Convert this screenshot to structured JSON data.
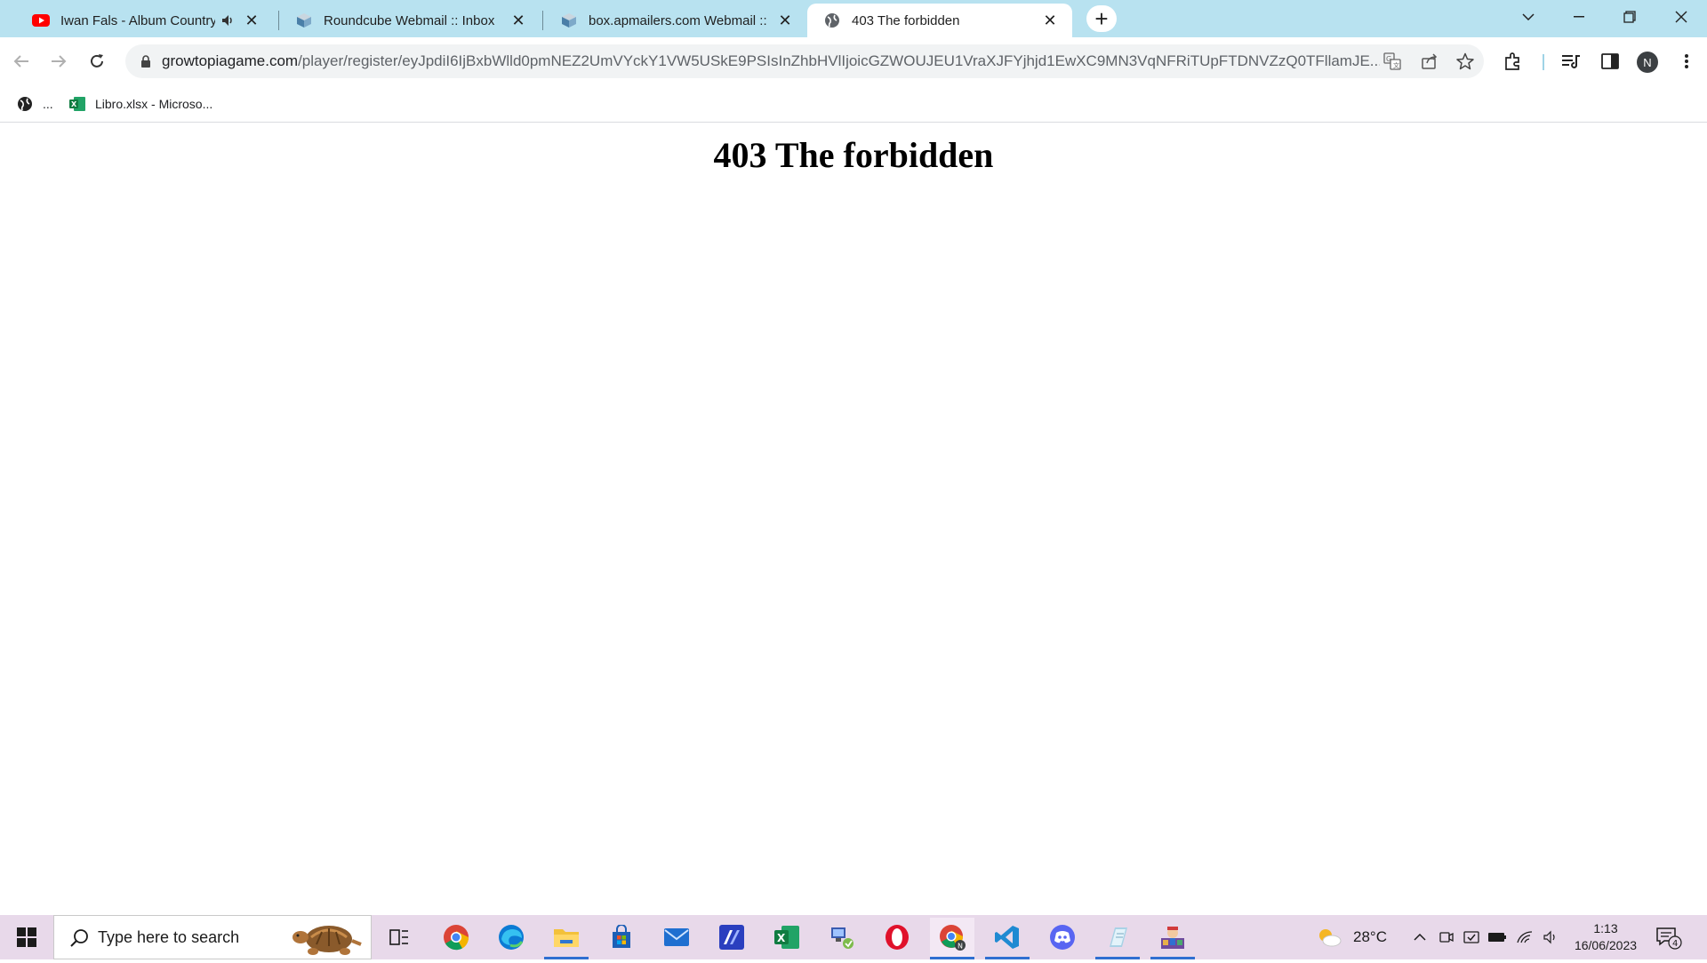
{
  "browser": {
    "tabs": [
      {
        "title": "Iwan Fals - Album Country |",
        "favicon": "youtube-icon",
        "audio": true,
        "active": false
      },
      {
        "title": "Roundcube Webmail :: Inbox",
        "favicon": "roundcube-icon",
        "active": false
      },
      {
        "title": "box.apmailers.com Webmail :: In",
        "favicon": "roundcube-icon",
        "active": false
      },
      {
        "title": "403 The forbidden",
        "favicon": "globe-icon",
        "active": true
      }
    ],
    "address_bar": {
      "host": "growtopiagame.com",
      "path": "/player/register/eyJpdiI6IjBxbWlld0pmNEZ2UmVYckY1VW5USkE9PSIsInZhbHVlIjoicGZWOUJEU1VraXJFYjhjd1EwXC9MN3VqNFRiTUpFTDNVZzQ0TFllamJE..."
    },
    "profile_initial": "N",
    "bookmarks": [
      {
        "label": "...",
        "icon": "globe-icon"
      },
      {
        "label": "Libro.xlsx - Microso...",
        "icon": "excel-icon"
      }
    ]
  },
  "page": {
    "heading": "403 The forbidden"
  },
  "taskbar": {
    "search_placeholder": "Type here to search",
    "apps": [
      "task-view",
      "chrome",
      "edge",
      "file-explorer",
      "microsoft-store",
      "mail",
      "editor",
      "excel",
      "network-tool",
      "opera",
      "chrome-profile",
      "vscode",
      "discord",
      "notepad",
      "game"
    ],
    "weather": {
      "temp": "28°C",
      "icon": "sun-cloud-icon"
    },
    "clock": {
      "time": "1:13",
      "date": "16/06/2023"
    },
    "notifications": "4"
  },
  "colors": {
    "tabstrip": "#b8e2f0",
    "taskbar": "#e8d9ea",
    "accent": "#2f6fd1"
  }
}
